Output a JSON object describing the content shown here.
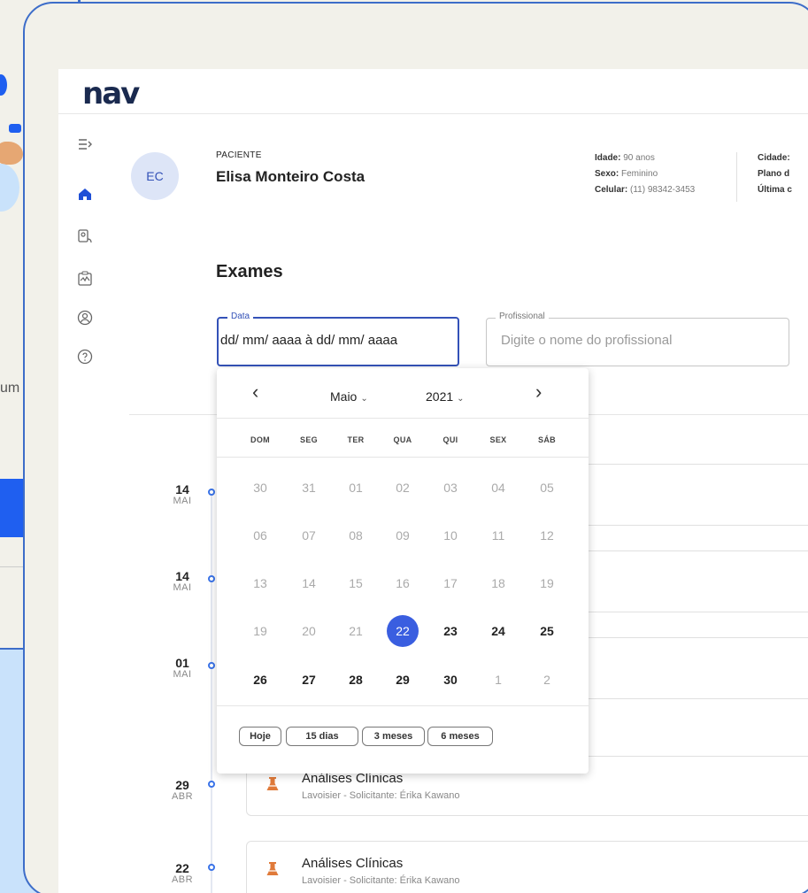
{
  "background": {
    "partial_text": "um"
  },
  "app": {
    "logo": "nav"
  },
  "sidebar": {
    "items": [
      {
        "name": "expand-menu-icon"
      },
      {
        "name": "home-icon"
      },
      {
        "name": "doctor-icon"
      },
      {
        "name": "exams-icon"
      },
      {
        "name": "profile-icon"
      },
      {
        "name": "help-icon"
      }
    ]
  },
  "patient": {
    "initials": "EC",
    "label": "PACIENTE",
    "name": "Elisa Monteiro Costa",
    "age_label": "Idade:",
    "age_value": "90 anos",
    "sex_label": "Sexo:",
    "sex_value": "Feminino",
    "phone_label": "Celular:",
    "phone_value": "(11) 98342-3453",
    "city_label": "Cidade:",
    "plan_label": "Plano d",
    "last_label": "Última c"
  },
  "page": {
    "title": "Exames"
  },
  "filters": {
    "date_legend": "Data",
    "date_value": "dd/ mm/ aaaa à dd/ mm/ aaaa",
    "prof_legend": "Profissional",
    "prof_placeholder": "Digite o nome do profissional"
  },
  "picker": {
    "prev": "‹",
    "next": "›",
    "month": "Maio",
    "year": "2021",
    "weekdays": [
      "DOM",
      "SEG",
      "TER",
      "QUA",
      "QUI",
      "SEX",
      "SÁB"
    ],
    "weeks": [
      [
        "30",
        "31",
        "01",
        "02",
        "03",
        "04",
        "05"
      ],
      [
        "06",
        "07",
        "08",
        "09",
        "10",
        "11",
        "12"
      ],
      [
        "13",
        "14",
        "15",
        "16",
        "17",
        "18",
        "19"
      ],
      [
        "19",
        "20",
        "21",
        "22",
        "23",
        "24",
        "25"
      ],
      [
        "26",
        "27",
        "28",
        "29",
        "30",
        "1",
        "2"
      ]
    ],
    "selected": "22",
    "shortcuts": [
      "Hoje",
      "15 dias",
      "3 meses",
      "6 meses"
    ]
  },
  "timeline": [
    {
      "day": "14",
      "month": "MAI"
    },
    {
      "day": "14",
      "month": "MAI"
    },
    {
      "day": "01",
      "month": "MAI"
    },
    {
      "day": "29",
      "month": "ABR",
      "title": "Análises Clínicas",
      "subtitle": "Lavoisier  -  Solicitante: Érika Kawano"
    },
    {
      "day": "22",
      "month": "ABR",
      "title": "Análises Clínicas",
      "subtitle": "Lavoisier  -  Solicitante: Érika Kawano"
    }
  ],
  "colors": {
    "accent": "#3a5ee0",
    "border": "#3d6dc9",
    "lab_icon": "#e07a3a"
  }
}
